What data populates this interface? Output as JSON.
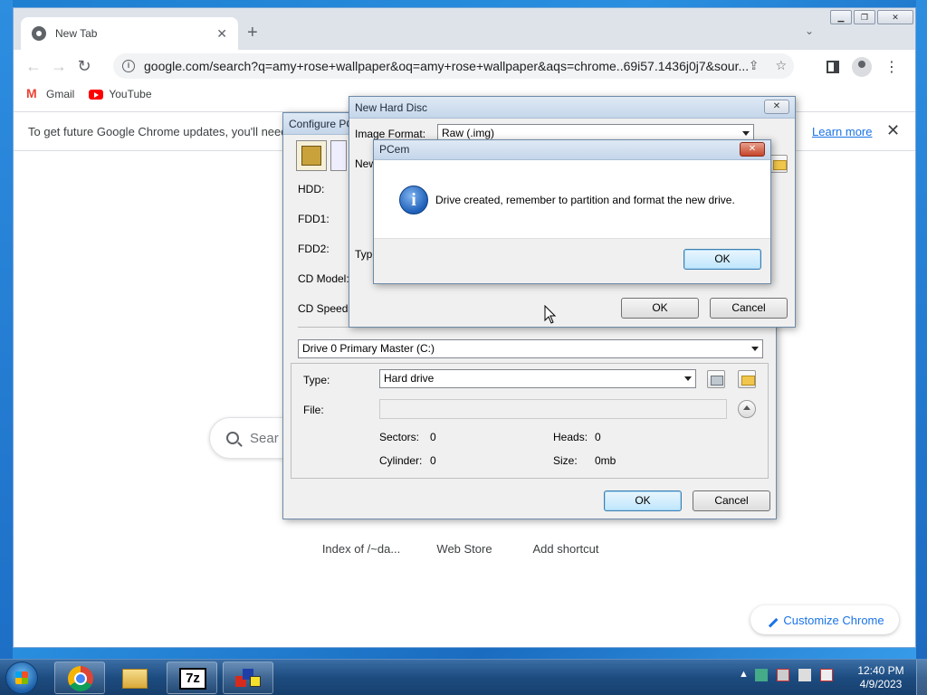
{
  "chrome": {
    "tab_title": "New Tab",
    "url": "google.com/search?q=amy+rose+wallpaper&oq=amy+rose+wallpaper&aqs=chrome..69i57.1436j0j7&sour...",
    "bookmarks": [
      {
        "label": "Gmail",
        "icon": "gmail-icon"
      },
      {
        "label": "YouTube",
        "icon": "youtube-icon"
      }
    ],
    "infobar_text": "To get future Google Chrome updates, you'll need",
    "infobar_link": "Learn more",
    "search_placeholder": "Sear",
    "shortcuts": [
      "Index of /~da...",
      "Web Store",
      "Add shortcut"
    ],
    "customize_label": "Customize Chrome"
  },
  "configure_dialog": {
    "title": "Configure PC",
    "labels": {
      "hdd": "HDD:",
      "fdd1": "FDD1:",
      "fdd2": "FDD2:",
      "cd_model": "CD Model:",
      "cd_speed": "CD Speed:"
    },
    "drive_select": "Drive 0 Primary Master (C:)",
    "type_label": "Type:",
    "type_value": "Hard drive",
    "file_label": "File:",
    "file_value": "",
    "sectors_label": "Sectors:",
    "sectors_value": "0",
    "heads_label": "Heads:",
    "heads_value": "0",
    "cylinder_label": "Cylinder:",
    "cylinder_value": "0",
    "size_label": "Size:",
    "size_value": "0mb",
    "ok": "OK",
    "cancel": "Cancel"
  },
  "new_hard_disc_dialog": {
    "title": "New Hard Disc",
    "image_format_label": "Image Format:",
    "image_format_value": "Raw (.img)",
    "new_label_fragment": "New",
    "type_label_fragment": "Typ",
    "ok": "OK",
    "cancel": "Cancel"
  },
  "pcem_message": {
    "title": "PCem",
    "message": "Drive created, remember to partition and format the new drive.",
    "ok": "OK",
    "icon": "info-icon"
  },
  "taskbar": {
    "items": [
      "chrome-icon",
      "explorer-icon",
      "7zip-icon",
      "pcem-icon"
    ],
    "sevenzip_text": "7z",
    "time": "12:40 PM",
    "date": "4/9/2023"
  }
}
